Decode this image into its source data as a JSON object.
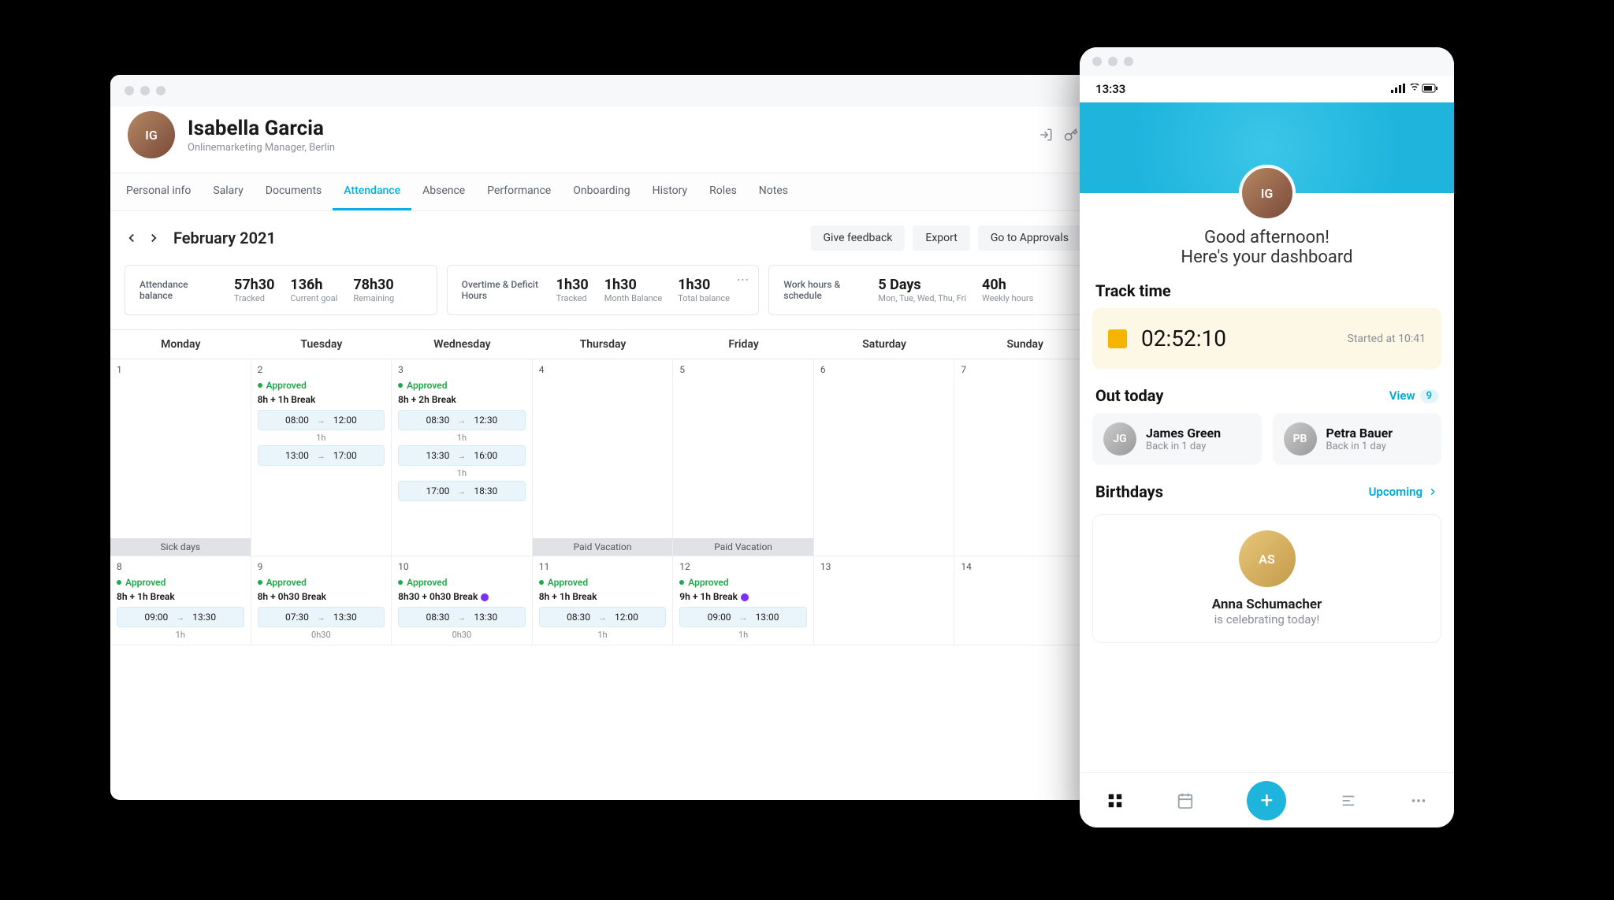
{
  "profile": {
    "name": "Isabella Garcia",
    "subtitle": "Onlinemarketing Manager, Berlin"
  },
  "tabs": {
    "items": [
      "Personal info",
      "Salary",
      "Documents",
      "Attendance",
      "Absence",
      "Performance",
      "Onboarding",
      "History",
      "Roles",
      "Notes"
    ],
    "active": "Attendance"
  },
  "toolbar": {
    "month": "February 2021",
    "buttons": {
      "feedback": "Give feedback",
      "export": "Export",
      "approvals": "Go to Approvals"
    }
  },
  "cards": {
    "attendance": {
      "title": "Attendance balance",
      "tracked": {
        "val": "57h30",
        "lbl": "Tracked"
      },
      "goal": {
        "val": "136h",
        "lbl": "Current goal"
      },
      "remain": {
        "val": "78h30",
        "lbl": "Remaining"
      }
    },
    "overtime": {
      "title": "Overtime & Deficit Hours",
      "tracked": {
        "val": "1h30",
        "lbl": "Tracked"
      },
      "month": {
        "val": "1h30",
        "lbl": "Month Balance"
      },
      "total": {
        "val": "1h30",
        "lbl": "Total balance"
      }
    },
    "schedule": {
      "title": "Work hours & schedule",
      "days": {
        "val": "5 Days",
        "lbl": "Mon, Tue, Wed, Thu, Fri"
      },
      "hours": {
        "val": "40h",
        "lbl": "Weekly hours"
      }
    }
  },
  "calendar": {
    "days": [
      "Monday",
      "Tuesday",
      "Wednesday",
      "Thursday",
      "Friday",
      "Saturday",
      "Sunday"
    ],
    "week1": {
      "mon": {
        "date": "1",
        "banner": "Sick days"
      },
      "tue": {
        "date": "2",
        "approved": "Approved",
        "summary": "8h + 1h Break",
        "slot1": {
          "a": "08:00",
          "b": "12:00"
        },
        "break1": "1h",
        "slot2": {
          "a": "13:00",
          "b": "17:00"
        }
      },
      "wed": {
        "date": "3",
        "approved": "Approved",
        "summary": "8h + 2h Break",
        "slot1": {
          "a": "08:30",
          "b": "12:30"
        },
        "break1": "1h",
        "slot2": {
          "a": "13:30",
          "b": "16:00"
        },
        "break2": "1h",
        "slot3": {
          "a": "17:00",
          "b": "18:30"
        }
      },
      "thu": {
        "date": "4",
        "banner": "Paid Vacation"
      },
      "fri": {
        "date": "5",
        "banner": "Paid Vacation"
      },
      "sat": {
        "date": "6"
      },
      "sun": {
        "date": "7"
      }
    },
    "week2": {
      "mon": {
        "date": "8",
        "approved": "Approved",
        "summary": "8h + 1h Break",
        "slot1": {
          "a": "09:00",
          "b": "13:30"
        },
        "break1": "1h"
      },
      "tue": {
        "date": "9",
        "approved": "Approved",
        "summary": "8h + 0h30 Break",
        "slot1": {
          "a": "07:30",
          "b": "13:30"
        },
        "break1": "0h30"
      },
      "wed": {
        "date": "10",
        "approved": "Approved",
        "summary": "8h30 + 0h30 Break",
        "badge": true,
        "slot1": {
          "a": "08:30",
          "b": "13:30"
        },
        "break1": "0h30"
      },
      "thu": {
        "date": "11",
        "approved": "Approved",
        "summary": "8h + 1h Break",
        "slot1": {
          "a": "08:30",
          "b": "12:00"
        },
        "break1": "1h"
      },
      "fri": {
        "date": "12",
        "approved": "Approved",
        "summary": "9h + 1h Break",
        "badge": true,
        "slot1": {
          "a": "09:00",
          "b": "13:00"
        },
        "break1": "1h"
      },
      "sat": {
        "date": "13"
      },
      "sun": {
        "date": "14"
      }
    }
  },
  "mobile": {
    "statusTime": "13:33",
    "greet1": "Good afternoon!",
    "greet2": "Here's your dashboard",
    "trackTitle": "Track time",
    "trackTime": "02:52:10",
    "trackSub": "Started at 10:41",
    "outTitle": "Out today",
    "outLink": "View",
    "outCount": "9",
    "out": [
      {
        "name": "James Green",
        "sub": "Back in 1 day"
      },
      {
        "name": "Petra Bauer",
        "sub": "Back in 1 day"
      }
    ],
    "bdayTitle": "Birthdays",
    "bdayLink": "Upcoming",
    "bdayName": "Anna Schumacher",
    "bdaySub": "is celebrating today!"
  }
}
